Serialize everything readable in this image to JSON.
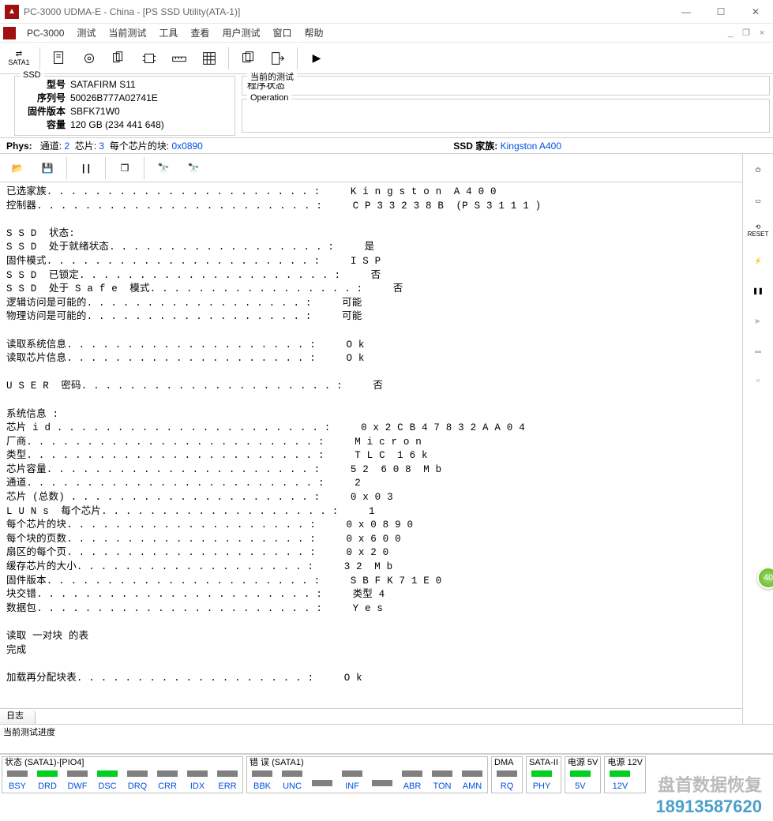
{
  "window": {
    "title": "PC-3000 UDMA-E - China - [PS SSD Utility(ATA-1)]"
  },
  "menu": {
    "app": "PC-3000",
    "items": [
      "测试",
      "当前测试",
      "工具",
      "查看",
      "用户测试",
      "窗口",
      "帮助"
    ]
  },
  "ssd_info": {
    "legend": "SSD",
    "model_lbl": "型号",
    "model": "SATAFIRM   S11",
    "serial_lbl": "序列号",
    "serial": "50026B777A02741E",
    "fw_lbl": "固件版本",
    "fw": "SBFK71W0",
    "cap_lbl": "容量",
    "cap": "120 GB (234 441 648)"
  },
  "current_test": {
    "legend": "当前的测试",
    "state": "程序状态",
    "op_legend": "Operation",
    "op": ""
  },
  "phys": {
    "label": "Phys:",
    "ch_lbl": "通道:",
    "ch": "2",
    "chip_lbl": "芯片:",
    "chip": "3",
    "blk_lbl": "每个芯片的块:",
    "blk": "0x0890",
    "fam_lbl": "SSD 家族:",
    "fam": "Kingston A400"
  },
  "log_lines": [
    "已选家族. . . . . . . . . . . . . . . . . . . . . . :     Kingston A400",
    "控制器. . . . . . . . . . . . . . . . . . . . . . . :     CP33238B (PS3111)",
    "",
    "SSD 状态:",
    "SSD 处于就绪状态. . . . . . . . . . . . . . . . . . :     是",
    "固件模式. . . . . . . . . . . . . . . . . . . . . . :     ISP",
    "SSD 已锁定. . . . . . . . . . . . . . . . . . . . . :     否",
    "SSD 处于 Safe 模式. . . . . . . . . . . . . . . . . :     否",
    "逻辑访问是可能的. . . . . . . . . . . . . . . . . . :     可能",
    "物理访问是可能的. . . . . . . . . . . . . . . . . . :     可能",
    "",
    "读取系统信息. . . . . . . . . . . . . . . . . . . . :     Ok",
    "读取芯片信息. . . . . . . . . . . . . . . . . . . . :     Ok",
    "",
    "USER 密码. . . . . . . . . . . . . . . . . . . . . :     否",
    "",
    "系统信息 :",
    "芯片 id. . . . . . . . . . . . . . . . . . . . . . :     0x2CB47832AA04",
    "厂商. . . . . . . . . . . . . . . . . . . . . . . . :     Micron",
    "类型. . . . . . . . . . . . . . . . . . . . . . . . :     TLC 16k",
    "芯片容量. . . . . . . . . . . . . . . . . . . . . . :     52 608 Mb",
    "通道. . . . . . . . . . . . . . . . . . . . . . . . :     2",
    "芯片 (总数) . . . . . . . . . . . . . . . . . . . . :     0x03",
    "LUNs 每个芯片. . . . . . . . . . . . . . . . . . . :     1",
    "每个芯片的块. . . . . . . . . . . . . . . . . . . . :     0x0890",
    "每个块的页数. . . . . . . . . . . . . . . . . . . . :     0x600",
    "扇区的每个页. . . . . . . . . . . . . . . . . . . . :     0x20",
    "缓存芯片的大小. . . . . . . . . . . . . . . . . . . :     32 Mb",
    "固件版本. . . . . . . . . . . . . . . . . . . . . . :     SBFK71E0",
    "块交错. . . . . . . . . . . . . . . . . . . . . . . :     类型 4",
    "数据包. . . . . . . . . . . . . . . . . . . . . . . :     Yes",
    "",
    "读取 一对块 的表",
    "完成",
    "",
    "加载再分配块表. . . . . . . . . . . . . . . . . . . :     Ok"
  ],
  "log_tab": "日志",
  "progress_label": "当前测试进度",
  "status": {
    "g1": {
      "title": "状态 (SATA1)-[PIO4]",
      "cells": [
        {
          "l": "BSY",
          "on": false
        },
        {
          "l": "DRD",
          "on": true
        },
        {
          "l": "DWF",
          "on": false
        },
        {
          "l": "DSC",
          "on": true
        },
        {
          "l": "DRQ",
          "on": false
        },
        {
          "l": "CRR",
          "on": false
        },
        {
          "l": "IDX",
          "on": false
        },
        {
          "l": "ERR",
          "on": false
        }
      ]
    },
    "g2": {
      "title": "错 误 (SATA1)",
      "cells": [
        {
          "l": "BBK",
          "on": false
        },
        {
          "l": "UNC",
          "on": false
        },
        {
          "l": "",
          "on": false
        },
        {
          "l": "INF",
          "on": false
        },
        {
          "l": "",
          "on": false
        },
        {
          "l": "ABR",
          "on": false
        },
        {
          "l": "TON",
          "on": false
        },
        {
          "l": "AMN",
          "on": false
        }
      ]
    },
    "g3": {
      "title": "DMA",
      "cells": [
        {
          "l": "RQ",
          "on": false
        }
      ]
    },
    "g4": {
      "title": "SATA-II",
      "cells": [
        {
          "l": "PHY",
          "on": true
        }
      ]
    },
    "g5": {
      "title": "电源 5V",
      "cells": [
        {
          "l": "5V",
          "on": true
        }
      ]
    },
    "g6": {
      "title": "电源 12V",
      "cells": [
        {
          "l": "12V",
          "on": true
        }
      ]
    }
  },
  "watermark": {
    "l1": "盘首数据恢复",
    "l2": "18913587620"
  },
  "badge": "40",
  "sata_btn": "SATA1",
  "reset_btn": "RESET"
}
